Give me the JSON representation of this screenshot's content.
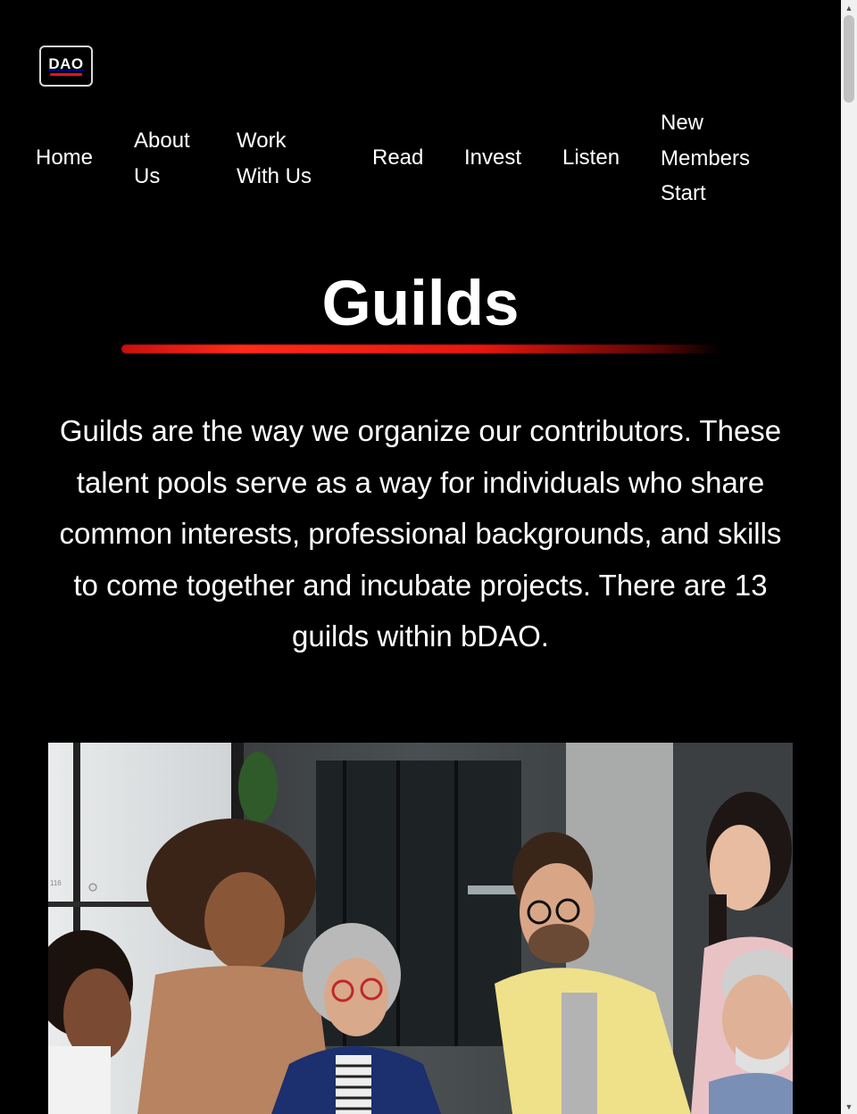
{
  "logo": {
    "text": "DAO",
    "accent_color": "#e0141c"
  },
  "nav": {
    "home": "Home",
    "about": "About Us",
    "work": "Work With Us",
    "read": "Read",
    "invest": "Invest",
    "listen": "Listen",
    "new_members": "New Members Start"
  },
  "hero": {
    "title": "Guilds",
    "intro": "Guilds are the way we organize our contributors. These talent pools serve as a way for individuals who share common interests, professional backgrounds, and skills to come together and incubate projects. There are 13 guilds within bDAO."
  },
  "photo": {
    "wall_tag": "116"
  },
  "colors": {
    "background": "#000000",
    "text": "#ffffff",
    "accent": "#e8160f"
  }
}
